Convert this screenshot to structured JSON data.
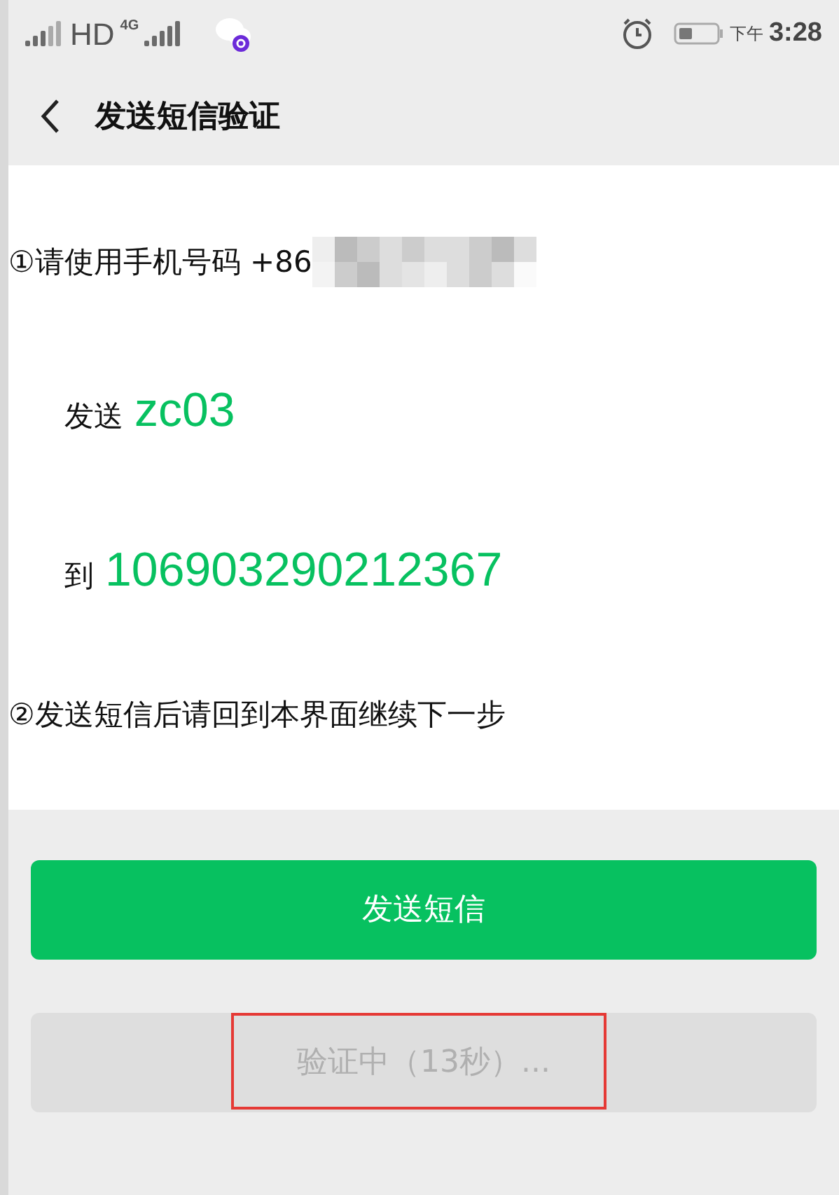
{
  "status_bar": {
    "network_label": "HD",
    "network_type": "4G",
    "time_period": "下午",
    "time": "3:28"
  },
  "header": {
    "title": "发送短信验证"
  },
  "steps": [
    {
      "kind": "phone",
      "text": "①请使用手机号码 +86"
    },
    {
      "kind": "content",
      "label": "发送",
      "value": "zc03"
    },
    {
      "kind": "content",
      "label": "到",
      "value": "106903290212367"
    },
    {
      "kind": "note",
      "text": "②发送短信后请回到本界面继续下一步"
    }
  ],
  "buttons": [
    {
      "label": "发送短信",
      "disabled": false
    },
    {
      "label": "验证中（13秒）...",
      "disabled": true,
      "highlighted": true
    }
  ]
}
